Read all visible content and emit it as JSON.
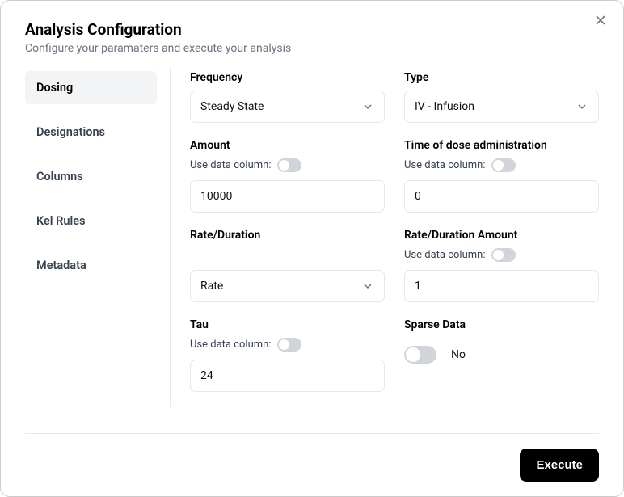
{
  "header": {
    "title": "Analysis Configuration",
    "subtitle": "Configure your paramaters and execute your analysis"
  },
  "sidebar": {
    "items": [
      {
        "label": "Dosing",
        "active": true
      },
      {
        "label": "Designations",
        "active": false
      },
      {
        "label": "Columns",
        "active": false
      },
      {
        "label": "Kel Rules",
        "active": false
      },
      {
        "label": "Metadata",
        "active": false
      }
    ]
  },
  "fields": {
    "frequency": {
      "label": "Frequency",
      "value": "Steady State"
    },
    "type": {
      "label": "Type",
      "value": "IV - Infusion"
    },
    "amount": {
      "label": "Amount",
      "use_data_col_label": "Use data column:",
      "value": "10000"
    },
    "time_of_dose": {
      "label": "Time of dose administration",
      "use_data_col_label": "Use data column:",
      "value": "0"
    },
    "rate_duration": {
      "label": "Rate/Duration",
      "value": "Rate"
    },
    "rate_duration_amount": {
      "label": "Rate/Duration Amount",
      "use_data_col_label": "Use data column:",
      "value": "1"
    },
    "tau": {
      "label": "Tau",
      "use_data_col_label": "Use data column:",
      "value": "24"
    },
    "sparse": {
      "label": "Sparse Data",
      "value_label": "No"
    }
  },
  "footer": {
    "execute_label": "Execute"
  }
}
